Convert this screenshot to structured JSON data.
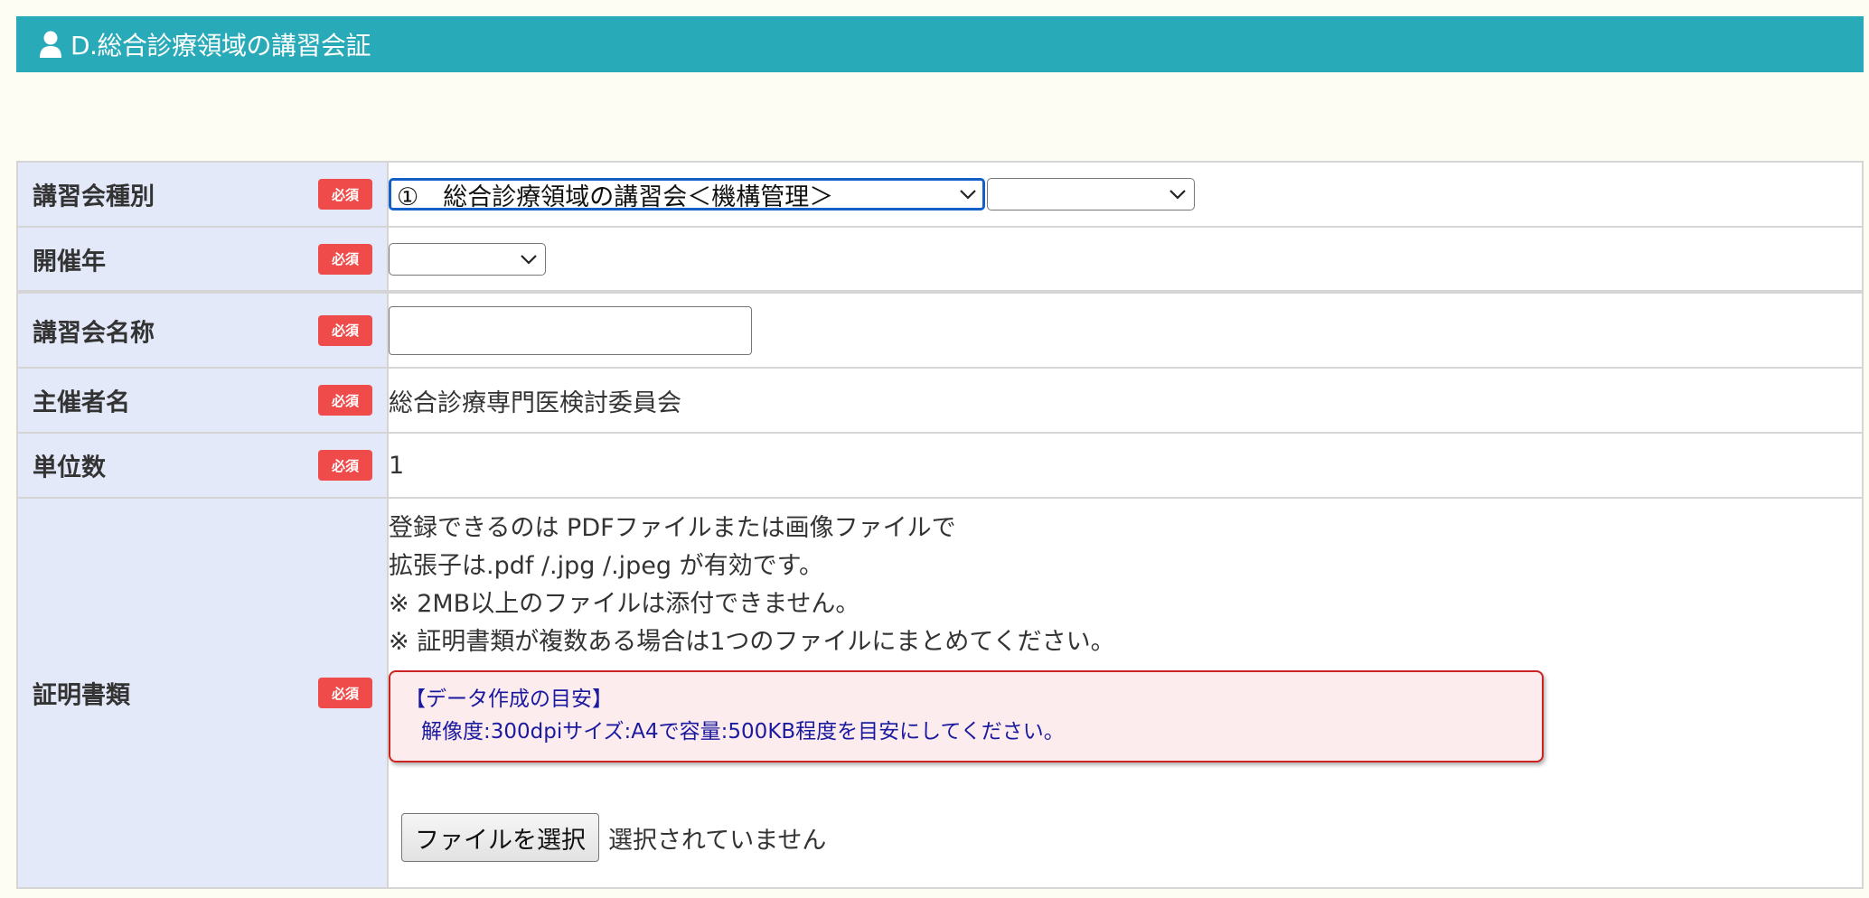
{
  "header": {
    "title": "D.総合診療領域の講習会証",
    "icon": "person-icon"
  },
  "required_label": "必須",
  "rows": {
    "type": {
      "label": "講習会種別",
      "select1_value": "①　総合診療領域の講習会＜機構管理＞",
      "select2_value": ""
    },
    "year": {
      "label": "開催年",
      "select_value": ""
    },
    "name": {
      "label": "講習会名称",
      "input_value": ""
    },
    "organizer": {
      "label": "主催者名",
      "value": "総合診療専門医検討委員会"
    },
    "units": {
      "label": "単位数",
      "value": "1"
    },
    "certificate": {
      "label": "証明書類",
      "lines": [
        "登録できるのは PDFファイルまたは画像ファイルで",
        "拡張子は.pdf /.jpg /.jpeg が有効です。",
        "※ 2MB以上のファイルは添付できません。",
        "※ 証明書類が複数ある場合は1つのファイルにまとめてください。"
      ],
      "guide_title": "【データ作成の目安】",
      "guide_body": "解像度:300dpiサイズ:A4で容量:500KB程度を目安にしてください。",
      "file_button": "ファイルを選択",
      "file_status": "選択されていません"
    }
  },
  "colors": {
    "header_bg": "#29aab8",
    "label_bg": "#e3e9f8",
    "required_badge": "#ef4b4b",
    "guide_border": "#cc2222",
    "guide_text": "#1a1aa0",
    "page_bg": "#fdfdf3"
  }
}
